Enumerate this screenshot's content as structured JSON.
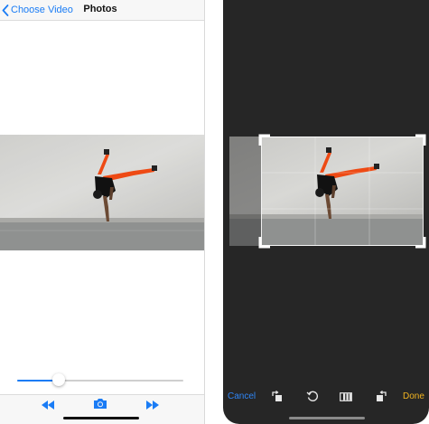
{
  "left_screen": {
    "nav": {
      "back_label": "Choose Video",
      "title": "Photos"
    },
    "scrubber": {
      "progress": 0.25
    },
    "toolbar": {
      "icons": [
        "rewind-icon",
        "camera-icon",
        "fast-forward-icon"
      ]
    }
  },
  "right_screen": {
    "bottom_bar": {
      "cancel_label": "Cancel",
      "done_label": "Done",
      "icons": [
        "rotate-left-icon",
        "undo-rotate-icon",
        "aspect-ratio-icon",
        "rotate-right-icon"
      ]
    }
  },
  "colors": {
    "accent_blue": "#1a7cf5",
    "done_yellow": "#f1b320",
    "right_background": "#262626",
    "pants_orange": "#ee4a14"
  }
}
